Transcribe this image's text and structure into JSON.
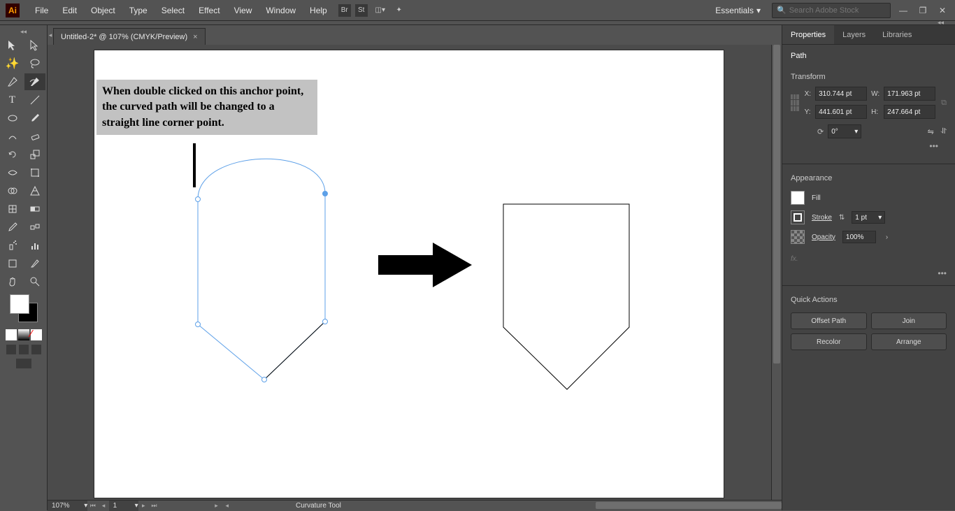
{
  "app": {
    "logo": "Ai"
  },
  "menu": [
    "File",
    "Edit",
    "Object",
    "Type",
    "Select",
    "Effect",
    "View",
    "Window",
    "Help"
  ],
  "workspace": "Essentials",
  "search_placeholder": "Search Adobe Stock",
  "doc_tab": "Untitled-2* @ 107% (CMYK/Preview)",
  "annotation": "When double clicked on this anchor point, the curved path will be changed to a straight line corner point.",
  "zoom": "107%",
  "page_num": "1",
  "status_tool": "Curvature Tool",
  "panels": {
    "tabs": [
      "Properties",
      "Layers",
      "Libraries"
    ],
    "selection_type": "Path",
    "transform": {
      "header": "Transform",
      "x_label": "X:",
      "y_label": "Y:",
      "w_label": "W:",
      "h_label": "H:",
      "x": "310.744 pt",
      "y": "441.601 pt",
      "w": "171.963 pt",
      "h": "247.664 pt",
      "angle_label": "",
      "angle": "0°"
    },
    "appearance": {
      "header": "Appearance",
      "fill_label": "Fill",
      "stroke_label": "Stroke",
      "stroke_val": "1 pt",
      "opacity_label": "Opacity",
      "opacity_val": "100%",
      "fx": "fx."
    },
    "quick_actions": {
      "header": "Quick Actions",
      "buttons": [
        "Offset Path",
        "Join",
        "Recolor",
        "Arrange"
      ]
    }
  }
}
